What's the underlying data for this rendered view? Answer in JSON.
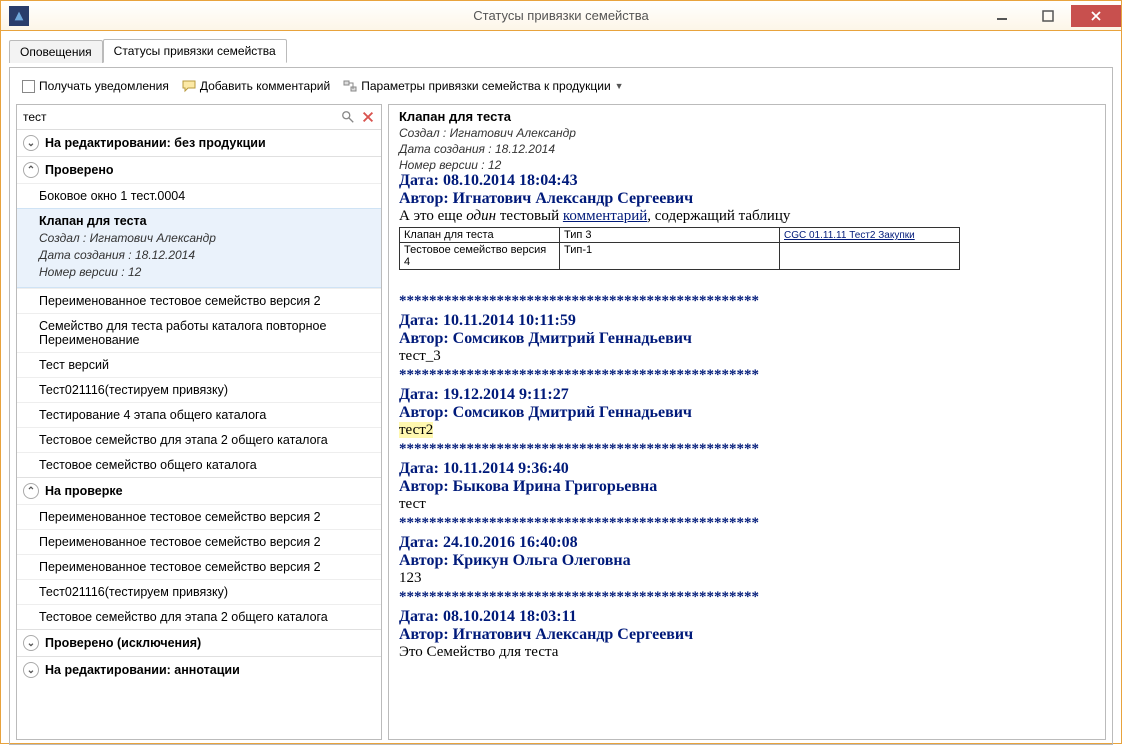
{
  "window": {
    "title": "Статусы привязки семейства"
  },
  "tabs": [
    {
      "label": "Оповещения",
      "active": false
    },
    {
      "label": "Статусы привязки семейства",
      "active": true
    }
  ],
  "toolbar": {
    "notify_label": "Получать уведомления",
    "add_comment_label": "Добавить комментарий",
    "binding_params_label": "Параметры привязки семейства к продукции"
  },
  "search": {
    "value": "тест"
  },
  "groups": {
    "g1": {
      "label": "На редактировании: без продукции",
      "expanded": false
    },
    "g2": {
      "label": "Проверено",
      "expanded": true
    },
    "g3": {
      "label": "На проверке",
      "expanded": true
    },
    "g4": {
      "label": "Проверено (исключения)",
      "expanded": false
    },
    "g5": {
      "label": "На редактировании: аннотации",
      "expanded": false
    }
  },
  "items": {
    "g2_0": "Боковое окно 1 тест.0004",
    "selected": {
      "title": "Клапан для теста",
      "created_by": "Создал :  Игнатович Александр",
      "created_date": "Дата создания :  18.12.2014",
      "version": "Номер версии :  12"
    },
    "g2_2": "Переименованное тестовое семейство версия 2",
    "g2_3": "Семейство для теста работы каталога повторное Переименование",
    "g2_4": "Тест версий",
    "g2_5": "Тест021116(тестируем привязку)",
    "g2_6": "Тестирование 4 этапа общего каталога",
    "g2_7": "Тестовое семейство для этапа 2 общего каталога",
    "g2_8": "Тестовое семейство общего каталога",
    "g3_0": "Переименованное тестовое семейство версия 2",
    "g3_1": "Переименованное тестовое семейство версия 2",
    "g3_2": "Переименованное тестовое семейство версия 2",
    "g3_3": "Тест021116(тестируем привязку)",
    "g3_4": "Тестовое семейство для этапа 2 общего каталога"
  },
  "detail": {
    "title": "Клапан для теста",
    "created_by": "Создал :  Игнатович Александр",
    "created_date": "Дата создания :  18.12.2014",
    "version": "Номер версии :  12",
    "stars": "************************************************",
    "entry1": {
      "date": "Дата: 08.10.2014 18:04:43",
      "author": "Автор: Игнатович Александр Сергеевич",
      "body_pre": "А это еще ",
      "body_em": "один",
      "body_mid": " тестовый ",
      "body_link": "комментарий",
      "body_post": ", содержащий таблицу",
      "table": {
        "r1c1": "Клапан для теста",
        "r1c2": "Тип 3",
        "r1c3": "CGC 01.11.11 Тест2 Закупки",
        "r2c1": "Тестовое семейство версия 4",
        "r2c2": "Тип-1",
        "r2c3": ""
      }
    },
    "entry2": {
      "date": "Дата: 10.11.2014 10:11:59",
      "author": "Автор: Сомсиков Дмитрий Геннадьевич",
      "body": "тест_3"
    },
    "entry3": {
      "date": "Дата: 19.12.2014 9:11:27",
      "author": "Автор: Сомсиков Дмитрий Геннадьевич",
      "body": "тест2"
    },
    "entry4": {
      "date": "Дата: 10.11.2014 9:36:40",
      "author": "Автор: Быкова Ирина Григорьевна",
      "body": "тест"
    },
    "entry5": {
      "date": "Дата: 24.10.2016 16:40:08",
      "author": "Автор: Крикун Ольга Олеговна",
      "body": "123"
    },
    "entry6": {
      "date": "Дата: 08.10.2014 18:03:11",
      "author": "Автор: Игнатович Александр Сергеевич",
      "body": "Это Семейство для теста"
    }
  }
}
